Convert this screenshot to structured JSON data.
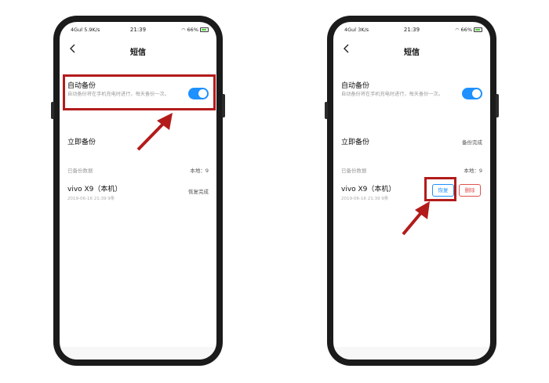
{
  "colors": {
    "accent": "#1e90ff",
    "highlight": "#b31b1b",
    "delete": "#e05050"
  },
  "phones": [
    {
      "status": {
        "signal": "4Gul",
        "speed": "5.9K/s",
        "time": "21:39",
        "battery": "66%"
      },
      "nav": {
        "title": "短信",
        "back_icon": "chevron-left-icon"
      },
      "auto_backup": {
        "title": "自动备份",
        "description": "自动备份将在手机充电时进行，每天备份一次。",
        "toggle_on": true
      },
      "backup_now": {
        "title": "立即备份",
        "action": ""
      },
      "backed_up_header": {
        "label": "已备份数据",
        "local_count": "本地：9"
      },
      "backup_item": {
        "device": "vivo X9（本机）",
        "date": "2019-06-16 21:39 9条",
        "status": "恢复完成"
      }
    },
    {
      "status": {
        "signal": "4Gul",
        "speed": "3K/s",
        "time": "21:39",
        "battery": "66%"
      },
      "nav": {
        "title": "短信",
        "back_icon": "chevron-left-icon"
      },
      "auto_backup": {
        "title": "自动备份",
        "description": "自动备份将在手机充电时进行，每天备份一次。",
        "toggle_on": true
      },
      "backup_now": {
        "title": "立即备份",
        "action": "备份完成"
      },
      "backed_up_header": {
        "label": "已备份数据",
        "local_count": "本地：9"
      },
      "backup_item": {
        "device": "vivo X9（本机）",
        "date": "2019-06-16 21:39 9条",
        "restore_label": "恢复",
        "delete_label": "删除"
      }
    }
  ]
}
